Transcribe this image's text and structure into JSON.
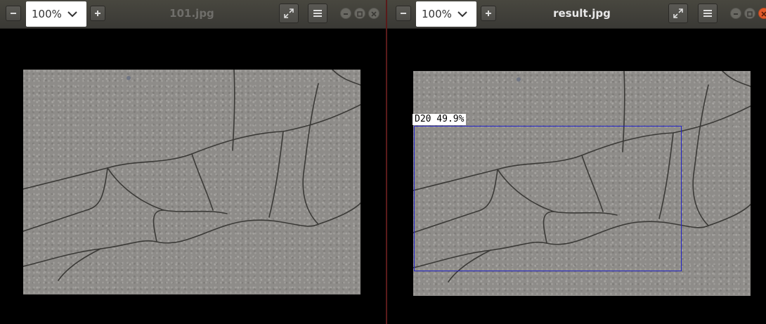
{
  "left_window": {
    "zoom_value": "100%",
    "title": "101.jpg",
    "title_color": "#6f6e6a",
    "icons": [
      "zoom-out-icon",
      "chevron-down-icon",
      "zoom-in-icon",
      "fullscreen-icon",
      "hamburger-menu-icon",
      "minimize-icon",
      "maximize-icon",
      "close-icon"
    ]
  },
  "right_window": {
    "zoom_value": "100%",
    "title": "result.jpg",
    "title_color": "#e8e8e8",
    "detection": {
      "label": "D20  49.9%",
      "box_color": "#2020c8"
    },
    "icons": [
      "zoom-out-icon",
      "chevron-down-icon",
      "zoom-in-icon",
      "fullscreen-icon",
      "hamburger-menu-icon",
      "minimize-icon",
      "maximize-icon",
      "close-icon"
    ]
  }
}
